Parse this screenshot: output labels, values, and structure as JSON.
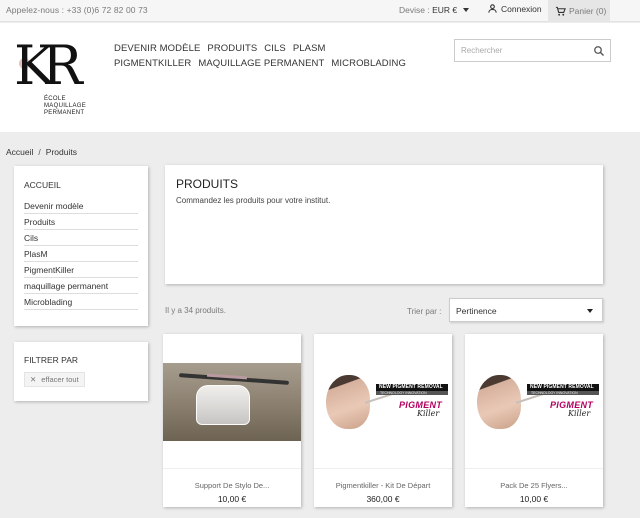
{
  "topbar": {
    "phone": "Appelez-nous : +33 (0)6 72 82 00 73",
    "currency_label": "Devise :",
    "currency_value": "EUR €",
    "login_label": "Connexion",
    "cart_label": "Panier (0)"
  },
  "logo": {
    "letters_left": "K",
    "letters_right": "R",
    "line1": "ÉCOLE",
    "line2": "MAQUILLAGE",
    "line3": "PERMANENT"
  },
  "nav": [
    "DEVENIR MODÈLE",
    "PRODUITS",
    "CILS",
    "PLASM",
    "PIGMENTKILLER",
    "MAQUILLAGE PERMANENT",
    "MICROBLADING"
  ],
  "search": {
    "placeholder": "Rechercher"
  },
  "breadcrumb": {
    "home": "Accueil",
    "current": "Produits"
  },
  "categories": {
    "title": "ACCUEIL",
    "items": [
      "Devenir modèle",
      "Produits",
      "Cils",
      "PlasM",
      "PigmentKiller",
      "maquillage permanent",
      "Microblading"
    ]
  },
  "filter": {
    "title": "FILTRER PAR",
    "clear_label": "effacer tout"
  },
  "intro": {
    "title": "PRODUITS",
    "description": "Commandez les produits pour votre institut."
  },
  "listing": {
    "count_text": "Il y a 34 produits.",
    "sort_label": "Trier par :",
    "sort_value": "Pertinence"
  },
  "products": [
    {
      "name": "Support De Stylo De...",
      "price": "10,00 €",
      "image": "stylo-support"
    },
    {
      "name": "Pigmentkiller - Kit De Départ",
      "price": "360,00 €",
      "image": "pigmentkiller"
    },
    {
      "name": "Pack De 25 Flyers...",
      "price": "10,00 €",
      "image": "pigmentkiller"
    }
  ],
  "pk_art": {
    "banner": "NEW PIGMENT REMOVAL",
    "banner_sub": "TECHNOLOGY INNOVATION",
    "word": "PIGMENT",
    "word2": "Killer"
  },
  "colors": {
    "accent_pink": "#b30060",
    "background": "#ededed"
  }
}
